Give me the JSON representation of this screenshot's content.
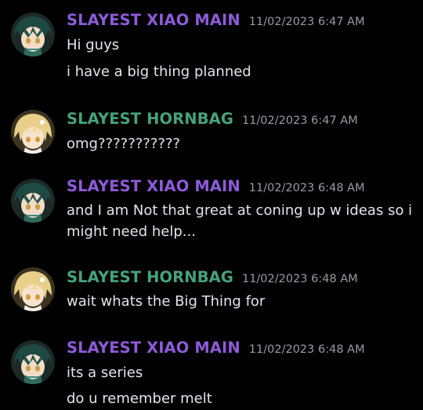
{
  "colors": {
    "background": "#000000",
    "xiao_username": "#8e5bd9",
    "hornbag_username": "#46a27e",
    "timestamp": "#9a9ca3",
    "message_text": "#e4e5e8"
  },
  "messages": [
    {
      "author": "SLAYEST XIAO MAIN",
      "timestamp": "11/02/2023 6:47 AM",
      "avatar": "xiao-avatar-icon",
      "lines": [
        "Hi guys",
        "i have a big thing planned"
      ]
    },
    {
      "author": "SLAYEST HORNBAG",
      "timestamp": "11/02/2023 6:47 AM",
      "avatar": "lumine-avatar-icon",
      "lines": [
        "omg???????????"
      ]
    },
    {
      "author": "SLAYEST XIAO MAIN",
      "timestamp": "11/02/2023 6:48 AM",
      "avatar": "xiao-avatar-icon",
      "lines": [
        "and I am Not that great at coning up w ideas so i",
        "might need help..."
      ]
    },
    {
      "author": "SLAYEST HORNBAG",
      "timestamp": "11/02/2023 6:48 AM",
      "avatar": "lumine-avatar-icon",
      "lines": [
        "wait whats the Big Thing for"
      ]
    },
    {
      "author": "SLAYEST XIAO MAIN",
      "timestamp": "11/02/2023 6:48 AM",
      "avatar": "xiao-avatar-icon",
      "lines": [
        "its a series",
        "do u remember melt"
      ]
    }
  ]
}
